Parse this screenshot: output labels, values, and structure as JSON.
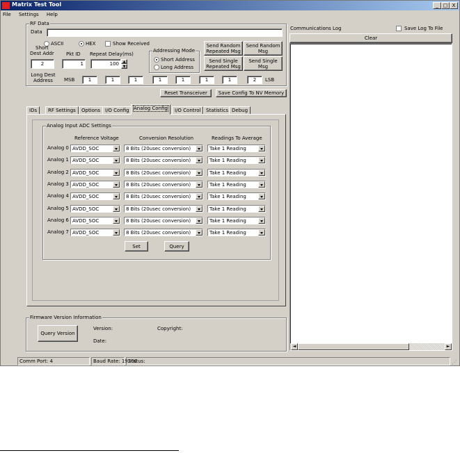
{
  "window": {
    "title": "Matrix Test Tool",
    "controls": {
      "minimize": "_",
      "maximize": "□",
      "close": "X"
    }
  },
  "menu": [
    "File",
    "Settings",
    "Help"
  ],
  "rf_data": {
    "group_label": "RF Data",
    "data_label": "Data",
    "data_value": "",
    "ascii_label": "ASCII",
    "hex_label": "HEX",
    "show_received_label": "Show Received",
    "short_label": "Short",
    "dest_addr_label": "Dest Addr",
    "dest_addr_value": "2",
    "pkt_id_label": "Pkt ID",
    "pkt_id_value": "1",
    "repeat_delay_label": "Repeat Delay(ms)",
    "repeat_delay_value": "100",
    "addressing_mode_label": "Addressing Mode",
    "short_address_label": "Short Address",
    "long_address_label": "Long Address",
    "send_random_repeated": "Send Random Repeated Msg",
    "send_random_msg": "Send Random Msg",
    "send_single_repeated": "Send Single Repeated Msg",
    "send_single_msg": "Send Single Msg",
    "long_dest_label": "Long Dest Address",
    "msb_label": "MSB",
    "lsb_label": "LSB",
    "long_bytes": [
      "1",
      "1",
      "1",
      "1",
      "1",
      "1",
      "1",
      "2"
    ]
  },
  "actions": {
    "reset_transceiver": "Reset Transceiver",
    "save_config": "Save Config To NV Memory"
  },
  "tabs": [
    {
      "label": "IDs",
      "active": false
    },
    {
      "label": "RF Settings",
      "active": false
    },
    {
      "label": "Options",
      "active": false
    },
    {
      "label": "I/O Config",
      "active": false
    },
    {
      "label": "Analog Config",
      "active": true
    },
    {
      "label": "I/O Control",
      "active": false
    },
    {
      "label": "Statistics",
      "active": false
    },
    {
      "label": "Debug",
      "active": false
    }
  ],
  "adc": {
    "group_label": "Analog Input ADC Settings",
    "col_reference": "Reference Voltage",
    "col_resolution": "Conversion Resolution",
    "col_readings": "Readings To Average",
    "rows": [
      {
        "label": "Analog 0",
        "ref": "AVDD_SOC",
        "res": "8 Bits  (20usec conversion)",
        "avg": "Take 1 Reading"
      },
      {
        "label": "Analog 1",
        "ref": "AVDD_SOC",
        "res": "8 Bits  (20usec conversion)",
        "avg": "Take 1 Reading"
      },
      {
        "label": "Analog 2",
        "ref": "AVDD_SOC",
        "res": "8 Bits  (20usec conversion)",
        "avg": "Take 1 Reading"
      },
      {
        "label": "Analog 3",
        "ref": "AVDD_SOC",
        "res": "8 Bits  (20usec conversion)",
        "avg": "Take 1 Reading"
      },
      {
        "label": "Analog 4",
        "ref": "AVDD_SOC",
        "res": "8 Bits  (20usec conversion)",
        "avg": "Take 1 Reading"
      },
      {
        "label": "Analog 5",
        "ref": "AVDD_SOC",
        "res": "8 Bits  (20usec conversion)",
        "avg": "Take 1 Reading"
      },
      {
        "label": "Analog 6",
        "ref": "AVDD_SOC",
        "res": "8 Bits  (20usec conversion)",
        "avg": "Take 1 Reading"
      },
      {
        "label": "Analog 7",
        "ref": "AVDD_SOC",
        "res": "8 Bits  (20usec conversion)",
        "avg": "Take 1 Reading"
      }
    ],
    "set_label": "Set",
    "query_label": "Query"
  },
  "firmware": {
    "group_label": "Firmware Version Information",
    "query_version": "Query Version",
    "version_label": "Version:",
    "date_label": "Date:",
    "copyright_label": "Copyright:"
  },
  "comm_log": {
    "label": "Communications Log",
    "save_log_label": "Save Log To File",
    "clear_label": "Clear"
  },
  "statusbar": {
    "comm_port": "Comm Port: 4",
    "baud_rate": "Baud Rate: 19200",
    "status": "Status:"
  }
}
